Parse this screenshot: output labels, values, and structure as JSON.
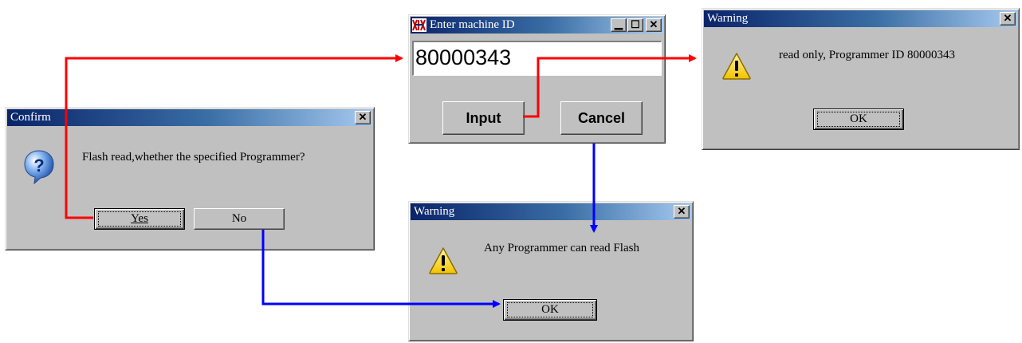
{
  "confirm": {
    "title": "Confirm",
    "message": "Flash read,whether the specified Programmer?",
    "yes_label": "Yes",
    "no_label": "No",
    "icon": "question-icon"
  },
  "machine_id": {
    "title": "Enter machine ID",
    "value": "80000343",
    "input_label": "Input",
    "cancel_label": "Cancel",
    "app_icon": "app-logo-icon"
  },
  "warning_readonly": {
    "title": "Warning",
    "message": "read only, Programmer ID 80000343",
    "ok_label": "OK",
    "icon": "warning-icon"
  },
  "warning_any": {
    "title": "Warning",
    "message": "Any Programmer can read Flash",
    "ok_label": "OK",
    "icon": "warning-icon"
  },
  "titlebar_buttons": {
    "close": "✕",
    "minimize": "▁",
    "maximize": "☐"
  },
  "colors": {
    "title_gradient_start": "#0a246a",
    "title_gradient_end": "#a6caf0",
    "dialog_face": "#c0c0c0",
    "arrow_red": "#ff0000",
    "arrow_blue": "#0000ff"
  }
}
